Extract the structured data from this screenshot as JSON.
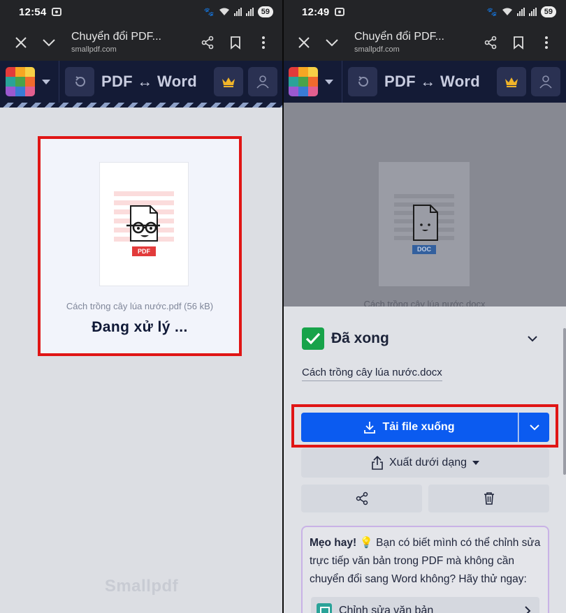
{
  "left": {
    "status": {
      "time": "12:54",
      "battery": "59"
    },
    "browser": {
      "title": "Chuyển đổi PDF...",
      "url": "smallpdf.com"
    },
    "app": {
      "title": "PDF ↔ Word"
    },
    "file": {
      "badge": "PDF",
      "name": "Cách trồng cây lúa nước.pdf (56 kB)",
      "status": "Đang xử lý ..."
    },
    "brand": "Smallpdf"
  },
  "right": {
    "status": {
      "time": "12:49",
      "battery": "59"
    },
    "browser": {
      "title": "Chuyển đổi PDF...",
      "url": "smallpdf.com"
    },
    "app": {
      "title": "PDF ↔ Word"
    },
    "preview": {
      "badge": "DOC",
      "name": "Cách trồng cây lúa nước.docx"
    },
    "result": {
      "done_label": "Đã xong",
      "output_name": "Cách trồng cây lúa nước.docx",
      "download_label": "Tải file xuống",
      "export_label": "Xuất dưới dạng"
    },
    "tip": {
      "bold": "Mẹo hay!",
      "emoji": "💡",
      "text": " Bạn có biết mình có thể chỉnh sửa trực tiếp văn bản trong PDF mà không cần chuyển đổi sang Word không? Hãy thử ngay:",
      "action": "Chỉnh sửa văn bản"
    }
  },
  "colors": {
    "accent": "#0b5bf0",
    "highlight": "#e01515",
    "success": "#17a34a",
    "appbar": "#141b36"
  }
}
